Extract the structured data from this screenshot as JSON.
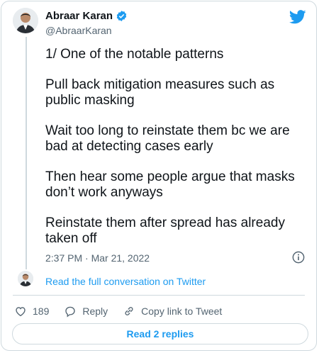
{
  "author": {
    "name": "Abraar Karan",
    "handle": "@AbraarKaran"
  },
  "tweet": {
    "paragraphs": [
      "1/ One of the notable patterns",
      "Pull back mitigation measures such as public masking",
      "Wait too long to reinstate them bc we are bad at detecting cases early",
      "Then hear some people argue that masks don’t work anyways",
      "Reinstate them after spread has already taken off"
    ],
    "timestamp": "2:37 PM · Mar 21, 2022"
  },
  "conversation_link": "Read the full conversation on Twitter",
  "actions": {
    "like_count": "189",
    "reply_label": "Reply",
    "copy_link_label": "Copy link to Tweet"
  },
  "replies_button": "Read 2 replies",
  "colors": {
    "accent": "#1d9bf0",
    "text": "#0f1419",
    "muted": "#536471",
    "border": "#cfd9de"
  },
  "icons": [
    "verified-badge-icon",
    "twitter-bird-icon",
    "info-icon",
    "heart-icon",
    "reply-bubble-icon",
    "link-icon"
  ]
}
